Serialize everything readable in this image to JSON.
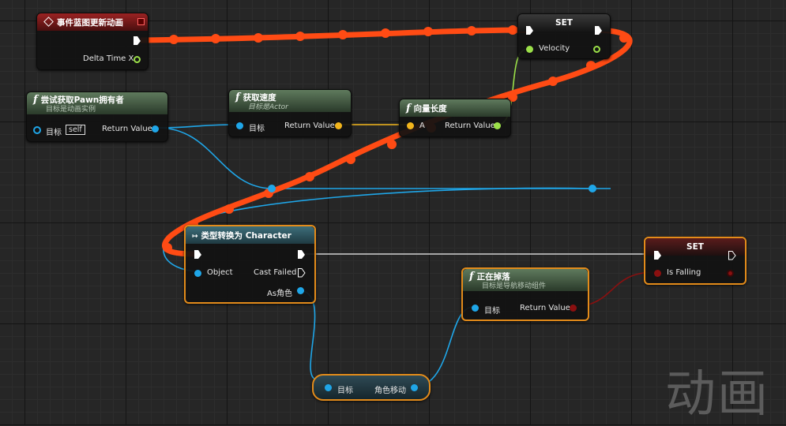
{
  "nodes": {
    "event_update": {
      "title": "事件蓝图更新动画",
      "pin_delta": "Delta Time X"
    },
    "try_get_pawn": {
      "title": "尝试获取Pawn拥有者",
      "subtitle": "目标是动画实例",
      "pin_target": "目标",
      "self_label": "self",
      "pin_return": "Return Value"
    },
    "get_velocity": {
      "title": "获取速度",
      "subtitle": "目标是Actor",
      "pin_target": "目标",
      "pin_return": "Return Value"
    },
    "vector_length": {
      "title": "向量长度",
      "pin_a": "A",
      "pin_return": "Return Value"
    },
    "set_velocity": {
      "title": "SET",
      "pin_value": "Velocity"
    },
    "cast_character": {
      "title": "类型转换为 Character",
      "pin_object": "Object",
      "pin_cast_failed": "Cast Failed",
      "pin_as": "As角色"
    },
    "character_movement": {
      "pin_target": "目标",
      "pin_return": "角色移动"
    },
    "is_falling_func": {
      "title": "正在掉落",
      "subtitle": "目标是导航移动组件",
      "pin_target": "目标",
      "pin_return": "Return Value"
    },
    "set_is_falling": {
      "title": "SET",
      "pin_value": "Is Falling"
    }
  },
  "watermark": "动画",
  "colors": {
    "exec_wire": "#ff4b14",
    "object_pin": "#1fa6e8",
    "vector_pin": "#f2b51c",
    "float_pin": "#9be049",
    "bool_pin": "#8a1010",
    "selection": "#e38b1a"
  }
}
